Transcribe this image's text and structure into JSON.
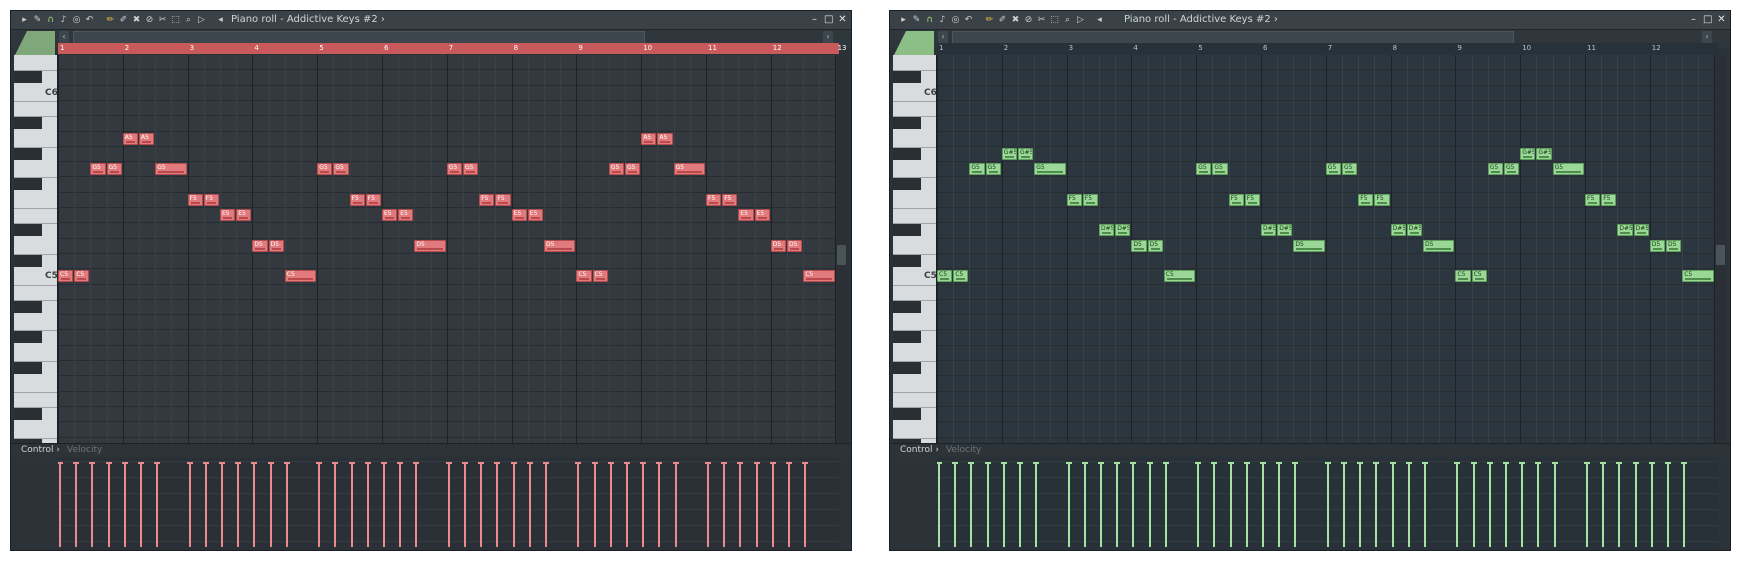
{
  "left_window": {
    "title": "Piano roll - Addictive Keys #2",
    "title_arrow": "›",
    "control_label": "Control ›",
    "control_param": "Velocity",
    "ruler": [
      "1",
      "2",
      "3",
      "4",
      "5",
      "6",
      "7",
      "8",
      "9",
      "10",
      "11",
      "12",
      "13"
    ],
    "key_labels": [
      "C6",
      "C5"
    ],
    "notes": [
      {
        "pitch": "C5",
        "start": 0.0,
        "len": 0.25
      },
      {
        "pitch": "C5",
        "start": 0.25,
        "len": 0.25
      },
      {
        "pitch": "G5",
        "start": 0.5,
        "len": 0.25
      },
      {
        "pitch": "G5",
        "start": 0.75,
        "len": 0.25
      },
      {
        "pitch": "A5",
        "start": 1.0,
        "len": 0.25
      },
      {
        "pitch": "A5",
        "start": 1.25,
        "len": 0.25
      },
      {
        "pitch": "G5",
        "start": 1.5,
        "len": 0.5
      },
      {
        "pitch": "F5",
        "start": 2.0,
        "len": 0.25
      },
      {
        "pitch": "F5",
        "start": 2.25,
        "len": 0.25
      },
      {
        "pitch": "E5",
        "start": 2.5,
        "len": 0.25
      },
      {
        "pitch": "E5",
        "start": 2.75,
        "len": 0.25
      },
      {
        "pitch": "D5",
        "start": 3.0,
        "len": 0.25
      },
      {
        "pitch": "D5",
        "start": 3.25,
        "len": 0.25
      },
      {
        "pitch": "C5",
        "start": 3.5,
        "len": 0.5
      },
      {
        "pitch": "G5",
        "start": 4.0,
        "len": 0.25
      },
      {
        "pitch": "G5",
        "start": 4.25,
        "len": 0.25
      },
      {
        "pitch": "F5",
        "start": 4.5,
        "len": 0.25
      },
      {
        "pitch": "F5",
        "start": 4.75,
        "len": 0.25
      },
      {
        "pitch": "E5",
        "start": 5.0,
        "len": 0.25
      },
      {
        "pitch": "E5",
        "start": 5.25,
        "len": 0.25
      },
      {
        "pitch": "D5",
        "start": 5.5,
        "len": 0.5
      },
      {
        "pitch": "G5",
        "start": 6.0,
        "len": 0.25
      },
      {
        "pitch": "G5",
        "start": 6.25,
        "len": 0.25
      },
      {
        "pitch": "F5",
        "start": 6.5,
        "len": 0.25
      },
      {
        "pitch": "F5",
        "start": 6.75,
        "len": 0.25
      },
      {
        "pitch": "E5",
        "start": 7.0,
        "len": 0.25
      },
      {
        "pitch": "E5",
        "start": 7.25,
        "len": 0.25
      },
      {
        "pitch": "D5",
        "start": 7.5,
        "len": 0.5
      },
      {
        "pitch": "C5",
        "start": 8.0,
        "len": 0.25
      },
      {
        "pitch": "C5",
        "start": 8.25,
        "len": 0.25
      },
      {
        "pitch": "G5",
        "start": 8.5,
        "len": 0.25
      },
      {
        "pitch": "G5",
        "start": 8.75,
        "len": 0.25
      },
      {
        "pitch": "A5",
        "start": 9.0,
        "len": 0.25
      },
      {
        "pitch": "A5",
        "start": 9.25,
        "len": 0.25
      },
      {
        "pitch": "G5",
        "start": 9.5,
        "len": 0.5
      },
      {
        "pitch": "F5",
        "start": 10.0,
        "len": 0.25
      },
      {
        "pitch": "F5",
        "start": 10.25,
        "len": 0.25
      },
      {
        "pitch": "E5",
        "start": 10.5,
        "len": 0.25
      },
      {
        "pitch": "E5",
        "start": 10.75,
        "len": 0.25
      },
      {
        "pitch": "D5",
        "start": 11.0,
        "len": 0.25
      },
      {
        "pitch": "D5",
        "start": 11.25,
        "len": 0.25
      },
      {
        "pitch": "C5",
        "start": 11.5,
        "len": 0.5
      }
    ]
  },
  "right_window": {
    "title": "Piano roll - Addictive Keys #2",
    "title_arrow": "›",
    "control_label": "Control ›",
    "control_param": "Velocity",
    "ruler": [
      "1",
      "2",
      "3",
      "4",
      "5",
      "6",
      "7",
      "8",
      "9",
      "10",
      "11",
      "12"
    ],
    "key_labels": [
      "C6",
      "C5"
    ],
    "notes": [
      {
        "pitch": "C5",
        "start": 0.0,
        "len": 0.25
      },
      {
        "pitch": "C5",
        "start": 0.25,
        "len": 0.25
      },
      {
        "pitch": "G5",
        "start": 0.5,
        "len": 0.25
      },
      {
        "pitch": "G5",
        "start": 0.75,
        "len": 0.25
      },
      {
        "pitch": "G#5",
        "start": 1.0,
        "len": 0.25
      },
      {
        "pitch": "G#5",
        "start": 1.25,
        "len": 0.25
      },
      {
        "pitch": "G5",
        "start": 1.5,
        "len": 0.5
      },
      {
        "pitch": "F5",
        "start": 2.0,
        "len": 0.25
      },
      {
        "pitch": "F5",
        "start": 2.25,
        "len": 0.25
      },
      {
        "pitch": "D#5",
        "start": 2.5,
        "len": 0.25
      },
      {
        "pitch": "D#5",
        "start": 2.75,
        "len": 0.25
      },
      {
        "pitch": "D5",
        "start": 3.0,
        "len": 0.25
      },
      {
        "pitch": "D5",
        "start": 3.25,
        "len": 0.25
      },
      {
        "pitch": "C5",
        "start": 3.5,
        "len": 0.5
      },
      {
        "pitch": "G5",
        "start": 4.0,
        "len": 0.25
      },
      {
        "pitch": "G5",
        "start": 4.25,
        "len": 0.25
      },
      {
        "pitch": "F5",
        "start": 4.5,
        "len": 0.25
      },
      {
        "pitch": "F5",
        "start": 4.75,
        "len": 0.25
      },
      {
        "pitch": "D#5",
        "start": 5.0,
        "len": 0.25
      },
      {
        "pitch": "D#5",
        "start": 5.25,
        "len": 0.25
      },
      {
        "pitch": "D5",
        "start": 5.5,
        "len": 0.5
      },
      {
        "pitch": "G5",
        "start": 6.0,
        "len": 0.25
      },
      {
        "pitch": "G5",
        "start": 6.25,
        "len": 0.25
      },
      {
        "pitch": "F5",
        "start": 6.5,
        "len": 0.25
      },
      {
        "pitch": "F5",
        "start": 6.75,
        "len": 0.25
      },
      {
        "pitch": "D#5",
        "start": 7.0,
        "len": 0.25
      },
      {
        "pitch": "D#5",
        "start": 7.25,
        "len": 0.25
      },
      {
        "pitch": "D5",
        "start": 7.5,
        "len": 0.5
      },
      {
        "pitch": "C5",
        "start": 8.0,
        "len": 0.25
      },
      {
        "pitch": "C5",
        "start": 8.25,
        "len": 0.25
      },
      {
        "pitch": "G5",
        "start": 8.5,
        "len": 0.25
      },
      {
        "pitch": "G5",
        "start": 8.75,
        "len": 0.25
      },
      {
        "pitch": "G#5",
        "start": 9.0,
        "len": 0.25
      },
      {
        "pitch": "G#5",
        "start": 9.25,
        "len": 0.25
      },
      {
        "pitch": "G5",
        "start": 9.5,
        "len": 0.5
      },
      {
        "pitch": "F5",
        "start": 10.0,
        "len": 0.25
      },
      {
        "pitch": "F5",
        "start": 10.25,
        "len": 0.25
      },
      {
        "pitch": "D#5",
        "start": 10.5,
        "len": 0.25
      },
      {
        "pitch": "D#5",
        "start": 10.75,
        "len": 0.25
      },
      {
        "pitch": "D5",
        "start": 11.0,
        "len": 0.25
      },
      {
        "pitch": "D5",
        "start": 11.25,
        "len": 0.25
      },
      {
        "pitch": "C5",
        "start": 11.5,
        "len": 0.5
      }
    ]
  },
  "toolbar_icons": [
    "arrow-icon",
    "wrench-icon",
    "magnet-icon",
    "note-icon",
    "record-icon",
    "undo-icon",
    "pencil-icon",
    "paint-icon",
    "delete-icon",
    "mute-icon",
    "slice-icon",
    "select-icon",
    "zoom-icon",
    "playback-icon",
    "speaker-icon"
  ],
  "window_buttons": {
    "minimize": "–",
    "maximize": "□",
    "close": "✕"
  },
  "colors": {
    "left_note": "#e07a7c",
    "right_note": "#9bd898",
    "ruler_left": "#c85a5c"
  }
}
